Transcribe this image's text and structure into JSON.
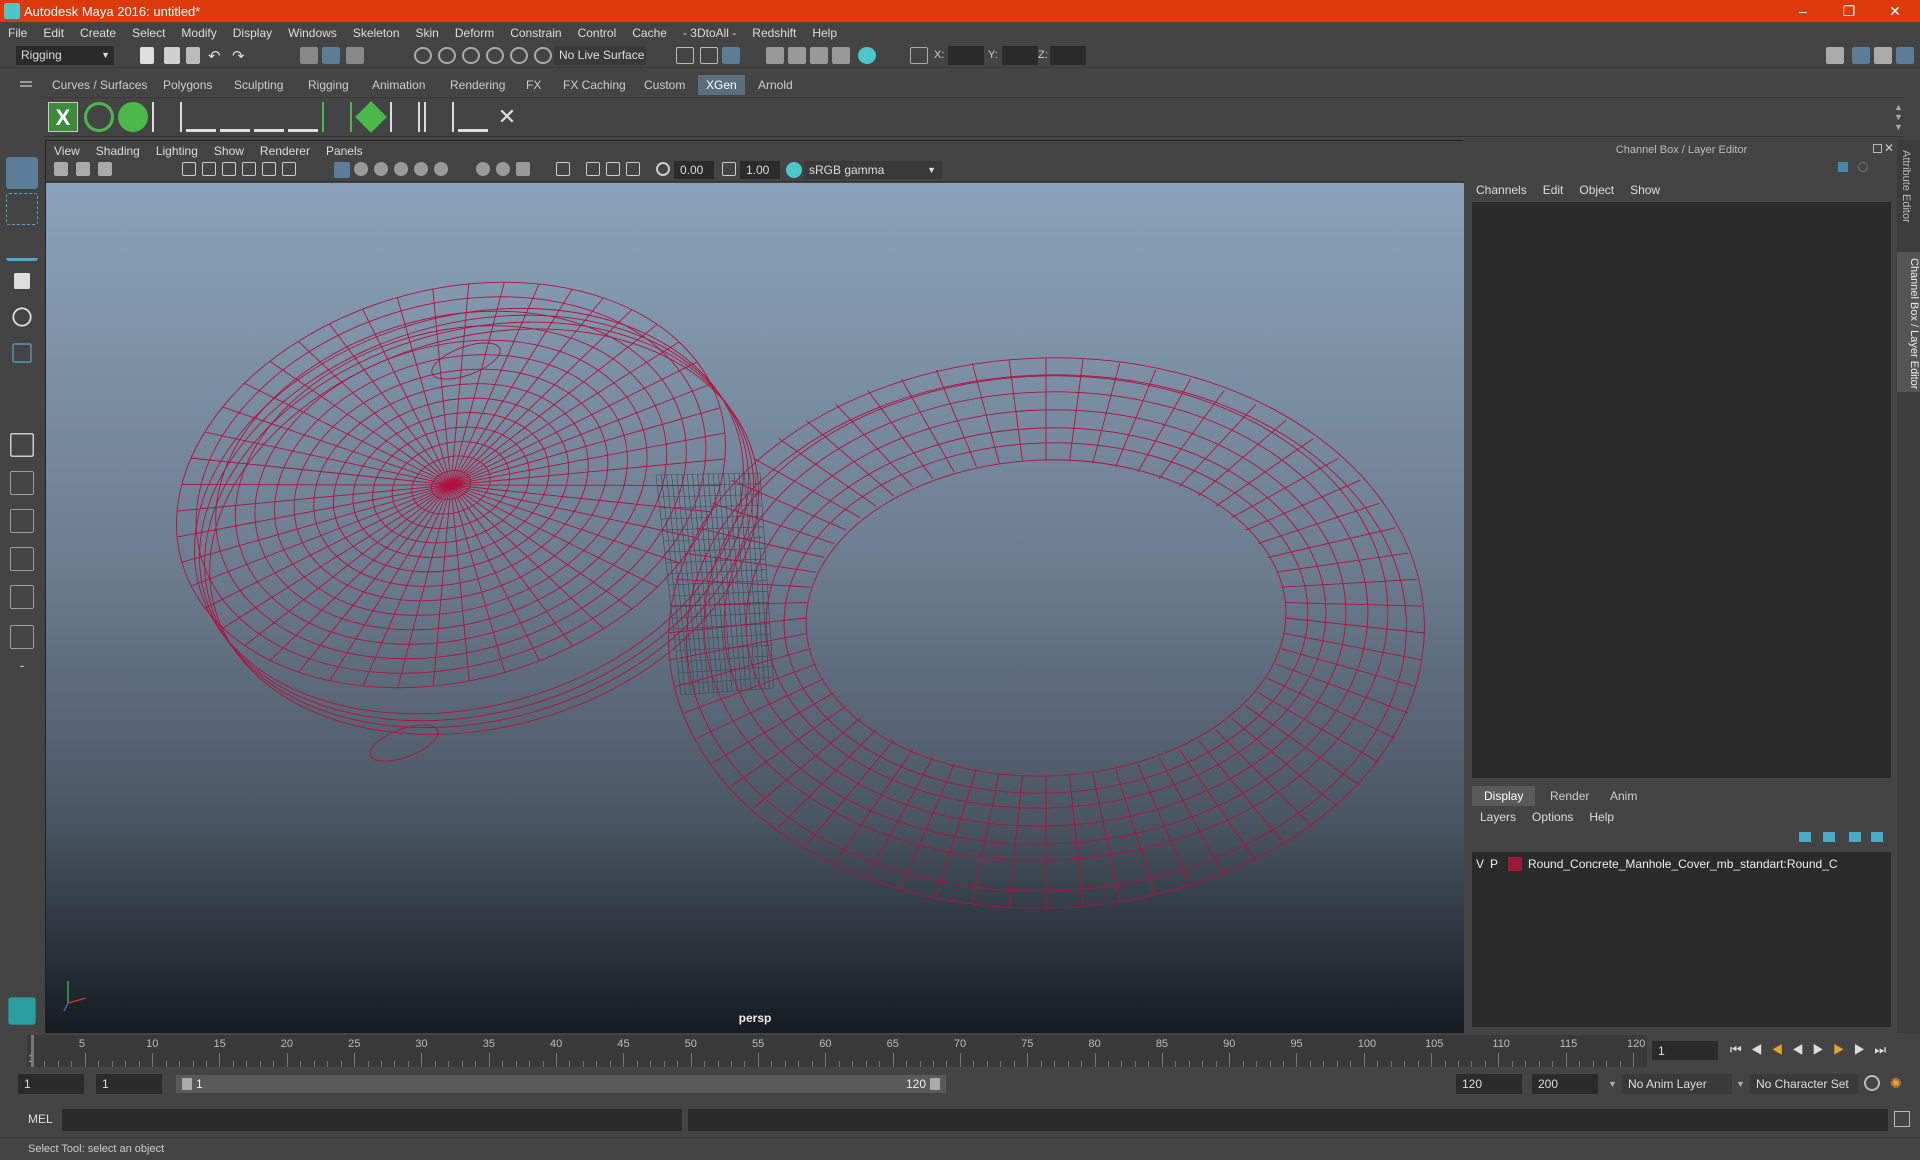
{
  "window": {
    "title": "Autodesk Maya 2016: untitled*"
  },
  "menubar": [
    "File",
    "Edit",
    "Create",
    "Select",
    "Modify",
    "Display",
    "Windows",
    "Skeleton",
    "Skin",
    "Deform",
    "Constrain",
    "Control",
    "Cache",
    "- 3DtoAll -",
    "Redshift",
    "Help"
  ],
  "toolbar": {
    "mode": "Rigging",
    "live_surface": "No Live Surface",
    "coord_labels": [
      "X:",
      "Y:",
      "Z:"
    ]
  },
  "shelf_tabs": [
    {
      "label": "Curves / Surfaces"
    },
    {
      "label": "Polygons"
    },
    {
      "label": "Sculpting"
    },
    {
      "label": "Rigging"
    },
    {
      "label": "Animation"
    },
    {
      "label": "Rendering"
    },
    {
      "label": "FX"
    },
    {
      "label": "FX Caching"
    },
    {
      "label": "Custom"
    },
    {
      "label": "XGen",
      "active": true
    },
    {
      "label": "Arnold"
    }
  ],
  "viewport": {
    "menu": [
      "View",
      "Shading",
      "Lighting",
      "Show",
      "Renderer",
      "Panels"
    ],
    "exposure": "0.00",
    "gamma": "1.00",
    "color_space": "sRGB gamma",
    "camera_label": "persp",
    "wire_color": "#b3113d"
  },
  "channel_box": {
    "title": "Channel Box / Layer Editor",
    "menu": [
      "Channels",
      "Edit",
      "Object",
      "Show"
    ]
  },
  "layer_editor": {
    "tabs": [
      {
        "label": "Display",
        "active": true
      },
      {
        "label": "Render"
      },
      {
        "label": "Anim"
      }
    ],
    "menu": [
      "Layers",
      "Options",
      "Help"
    ],
    "layer": {
      "v": "V",
      "p": "P",
      "color": "#9b1a35",
      "name": "Round_Concrete_Manhole_Cover_mb_standart:Round_C"
    }
  },
  "side_tabs": [
    "Attribute Editor",
    "Channel Box / Layer Editor"
  ],
  "timeline": {
    "ticks": [
      "5",
      "10",
      "15",
      "20",
      "25",
      "30",
      "35",
      "40",
      "45",
      "50",
      "55",
      "60",
      "65",
      "70",
      "75",
      "80",
      "85",
      "90",
      "95",
      "100",
      "105",
      "110",
      "115",
      "120"
    ],
    "start_tick": "1",
    "current_frame": "1"
  },
  "range": {
    "start": "1",
    "playback_start": "1",
    "slider_start": "1",
    "slider_end": "120",
    "playback_end": "120",
    "end": "200",
    "anim_layer": "No Anim Layer",
    "character_set": "No Character Set"
  },
  "cmdline": {
    "label": "MEL"
  },
  "help_line": "Select Tool: select an object"
}
